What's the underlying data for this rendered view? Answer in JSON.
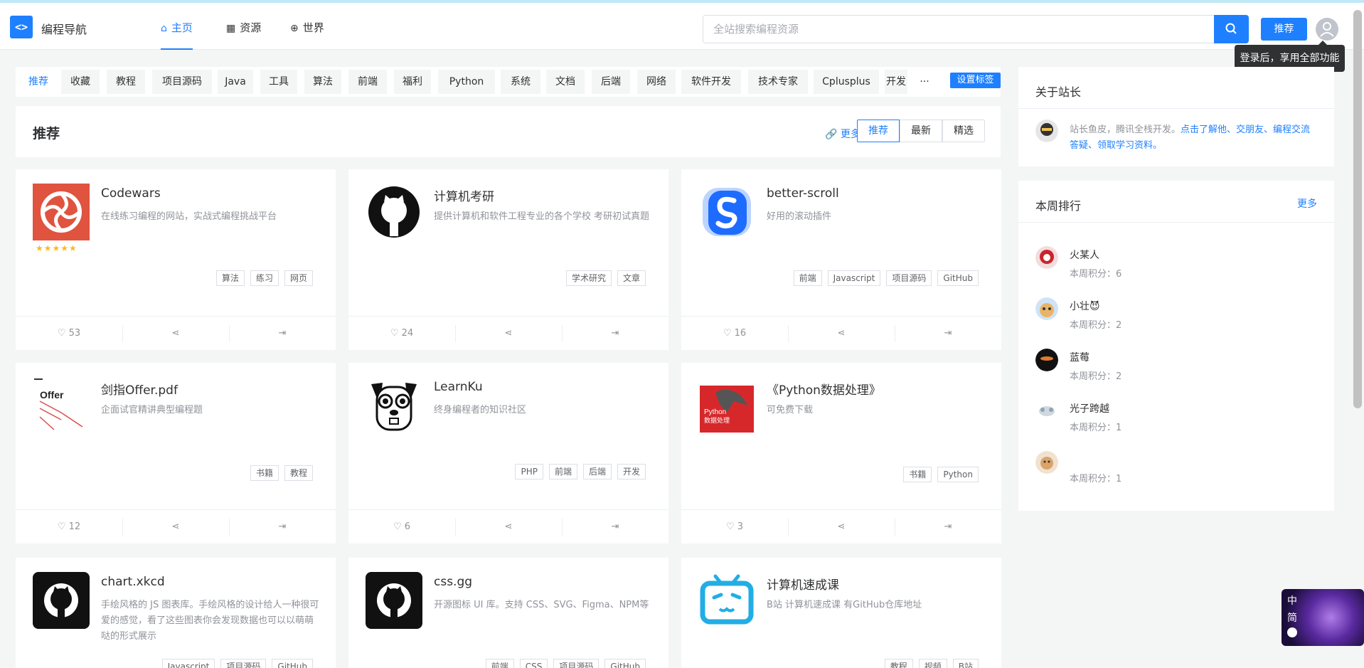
{
  "header": {
    "logo_mark": "<>",
    "logo_text": "编程导航",
    "nav": [
      {
        "label": "主页",
        "icon": "home-icon"
      },
      {
        "label": "资源",
        "icon": "grid-icon"
      },
      {
        "label": "世界",
        "icon": "globe-icon"
      }
    ],
    "search_placeholder": "全站搜索编程资源",
    "recommend_label": "推荐",
    "tooltip": "登录后，享用全部功能"
  },
  "tags": [
    "推荐",
    "收藏",
    "教程",
    "项目源码",
    "Java",
    "工具",
    "算法",
    "前端",
    "福利",
    "Python",
    "系统",
    "文档",
    "后端",
    "网络",
    "软件开发",
    "技术专家",
    "Cplusplus",
    "开发"
  ],
  "more_tags": "···",
  "set_tags_label": "设置标签",
  "recommend_section": {
    "title": "推荐",
    "more_label": "更多",
    "segments": [
      "推荐",
      "最新",
      "精选"
    ]
  },
  "cards": [
    {
      "title": "Codewars",
      "desc": "在线练习编程的网站，实战式编程挑战平台",
      "tags": [
        "算法",
        "练习",
        "网页"
      ],
      "likes": "53",
      "rating": 4.5,
      "stars_text": "★★★★★"
    },
    {
      "title": "计算机考研",
      "desc": "提供计算机和软件工程专业的各个学校 考研初试真题",
      "tags": [
        "学术研究",
        "文章"
      ],
      "likes": "24"
    },
    {
      "title": "better-scroll",
      "desc": "好用的滚动插件",
      "tags": [
        "前端",
        "Javascript",
        "项目源码",
        "GitHub"
      ],
      "likes": "16"
    },
    {
      "title": "剑指Offer.pdf",
      "desc": "企面试官精讲典型编程题",
      "tags": [
        "书籍",
        "教程"
      ],
      "likes": "12",
      "thumb_text": "Offer"
    },
    {
      "title": "LearnKu",
      "desc": "终身编程者的知识社区",
      "tags": [
        "PHP",
        "前端",
        "后端",
        "开发"
      ],
      "likes": "6"
    },
    {
      "title": "《Python数据处理》",
      "desc": "可免费下载",
      "tags": [
        "书籍",
        "Python"
      ],
      "likes": "3",
      "thumb_text": "Python\n数据处理"
    },
    {
      "title": "chart.xkcd",
      "desc": "手绘风格的 JS 图表库。手绘风格的设计给人一种很可爱的感觉，看了这些图表你会发现数据也可以以萌萌哒的形式展示",
      "tags": [
        "Javascript",
        "项目源码",
        "GitHub"
      ]
    },
    {
      "title": "css.gg",
      "desc": "开源图标 UI 库。支持 CSS、SVG、Figma、NPM等",
      "tags": [
        "前端",
        "CSS",
        "项目源码",
        "GitHub"
      ]
    },
    {
      "title": "计算机速成课",
      "desc": "B站 计算机速成课 有GitHub仓库地址",
      "tags": [
        "教程",
        "视频",
        "B站"
      ]
    }
  ],
  "about": {
    "title": "关于站长",
    "text_plain": "站长鱼皮，腾讯全栈开发。",
    "text_link": "点击了解他、交朋友、编程交流答疑、领取学习资料。"
  },
  "weekly": {
    "title": "本周排行",
    "more_label": "更多",
    "users": [
      {
        "name": "火某人",
        "score": "本周积分：6"
      },
      {
        "name": "小壮😈",
        "score": "本周积分：2"
      },
      {
        "name": "蓝莓",
        "score": "本周积分：2"
      },
      {
        "name": "光子跨越",
        "score": "本周积分：1"
      },
      {
        "name": "",
        "score": "本周积分：1"
      }
    ]
  },
  "lang_widget": {
    "line1": "中",
    "line2": "简"
  },
  "colors": {
    "primary": "#1e80ff",
    "bg": "#f4f5f5",
    "star": "#f7ba2a"
  }
}
